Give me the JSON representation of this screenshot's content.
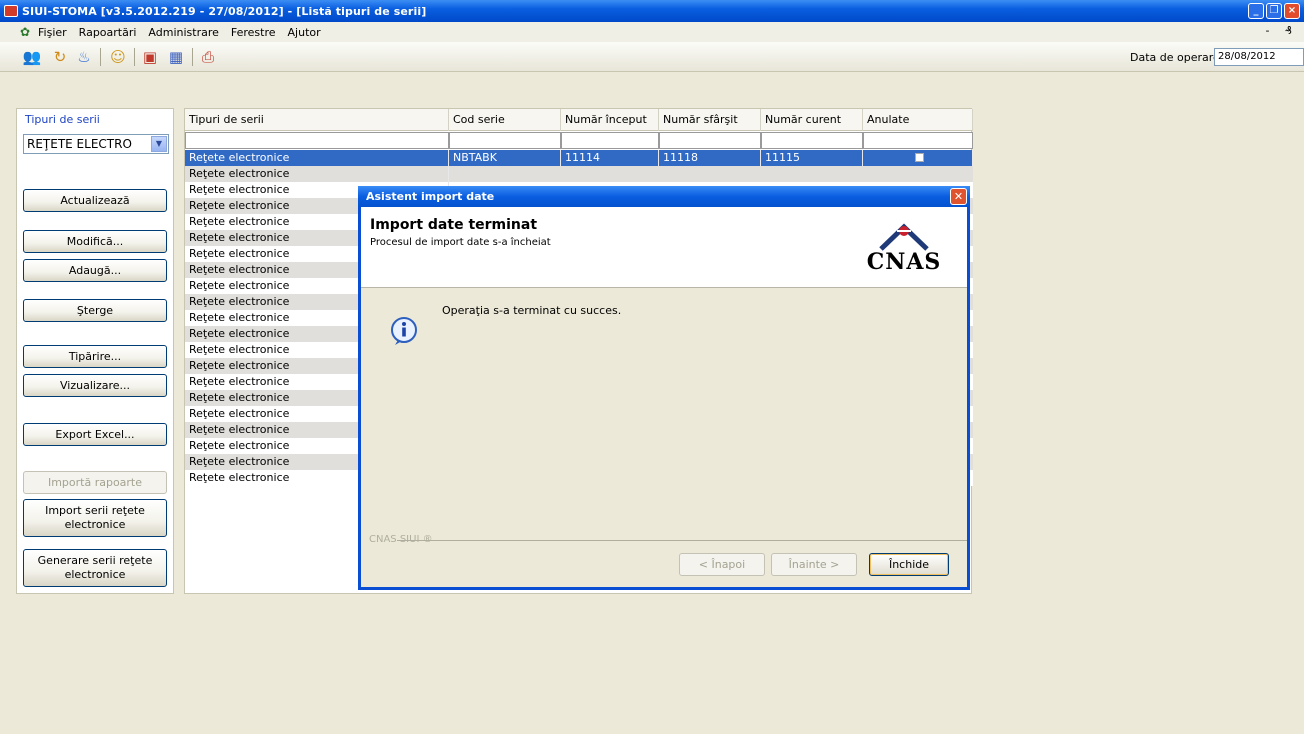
{
  "window": {
    "title": "SIUI-STOMA [v3.5.2012.219 - 27/08/2012] - [Listă tipuri de serii]",
    "controls": [
      "_",
      "❐",
      "×"
    ]
  },
  "menu": {
    "items": [
      "Fişier",
      "Rapoartări",
      "Administrare",
      "Ferestre",
      "Ajutor"
    ],
    "mdi_controls": "- ₰"
  },
  "toolbar": {
    "icons": [
      "users-icon",
      "refresh-icon",
      "drop-icon",
      "person-icon",
      "document-icon",
      "calendar-icon",
      "print-icon"
    ],
    "operation_label": "Data de operare",
    "operation_date": "28/08/2012"
  },
  "left_panel": {
    "label": "Tipuri de serii",
    "select_value": "REŢETE ELECTRO",
    "buttons": {
      "update": "Actualizează",
      "modify": "Modifică...",
      "add": "Adaugă...",
      "delete": "Şterge",
      "print": "Tipărire...",
      "preview": "Vizualizare...",
      "export": "Export Excel...",
      "import_disabled": "Importă rapoarte",
      "import_series_1": "Import serii reţete",
      "import_series_2": "electronice",
      "generate_series_1": "Generare serii reţete",
      "generate_series_2": "electronice"
    }
  },
  "grid": {
    "columns": [
      "Tipuri de serii",
      "Cod serie",
      "Număr început",
      "Număr sfârşit",
      "Număr curent",
      "Anulate"
    ],
    "selected_row": {
      "type": "Reţete electronice",
      "code": "NBTABK",
      "start": "11114",
      "end": "11118",
      "current": "11115"
    },
    "rows": [
      "Reţete electronice",
      "Reţete electronice",
      "Reţete electronice",
      "Reţete electronice",
      "Reţete electronice",
      "Reţete electronice",
      "Reţete electronice",
      "Reţete electronice",
      "Reţete electronice",
      "Reţete electronice",
      "Reţete electronice",
      "Reţete electronice",
      "Reţete electronice",
      "Reţete electronice",
      "Reţete electronice",
      "Reţete electronice",
      "Reţete electronice",
      "Reţete electronice",
      "Reţete electronice",
      "Reţete electronice"
    ]
  },
  "dialog": {
    "title": "Asistent import date",
    "header_title": "Import date terminat",
    "header_subtitle": "Procesul de import date s-a încheiat",
    "logo_text": "CNAS",
    "message": "Operaţia s-a terminat cu succes.",
    "footer_label": "CNAS SIUI ®",
    "back": "< Înapoi",
    "next": "Înainte >",
    "close": "Închide"
  },
  "colors": {
    "titlebar": "#0a5fe0",
    "selected_row": "#316ac5",
    "stripe_row": "#e0dfdc"
  }
}
